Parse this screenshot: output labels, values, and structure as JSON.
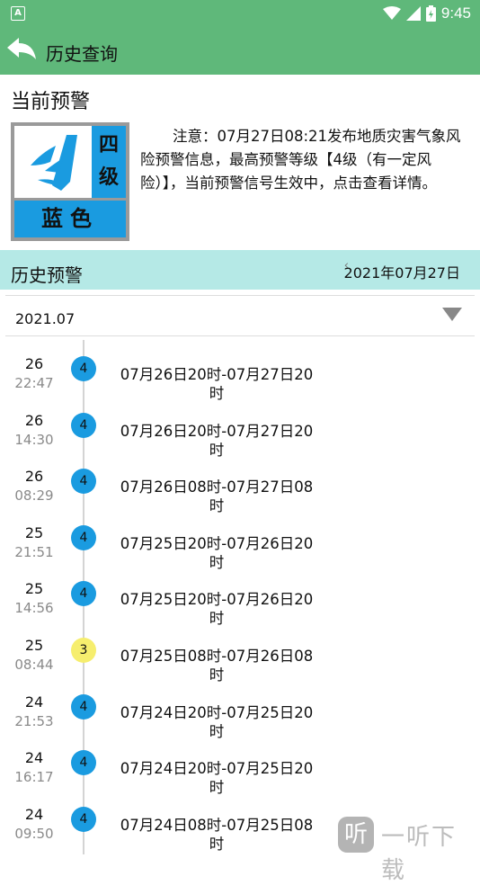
{
  "status_bar": {
    "left_icon": "A",
    "time": "9:45"
  },
  "app_bar": {
    "title": "历史查询"
  },
  "current": {
    "title": "当前预警",
    "badge": {
      "level": "四级",
      "color_name": "蓝色"
    },
    "notice": "注意：07月27日08:21发布地质灾害气象风险预警信息，最高预警等级【4级（有一定风险）】，当前预警信号生效中，点击查看详情。"
  },
  "history": {
    "title": "历史预警",
    "date": "2021年07月27日"
  },
  "month_select": {
    "value": "2021.07"
  },
  "records": [
    {
      "day": "26",
      "time": "22:47",
      "level": "4",
      "period_a": "07月26日20时-07月27日20",
      "period_b": "时"
    },
    {
      "day": "26",
      "time": "14:30",
      "level": "4",
      "period_a": "07月26日20时-07月27日20",
      "period_b": "时"
    },
    {
      "day": "26",
      "time": "08:29",
      "level": "4",
      "period_a": "07月26日08时-07月27日08",
      "period_b": "时"
    },
    {
      "day": "25",
      "time": "21:51",
      "level": "4",
      "period_a": "07月25日20时-07月26日20",
      "period_b": "时"
    },
    {
      "day": "25",
      "time": "14:56",
      "level": "4",
      "period_a": "07月25日20时-07月26日20",
      "period_b": "时"
    },
    {
      "day": "25",
      "time": "08:44",
      "level": "3",
      "period_a": "07月25日08时-07月26日08",
      "period_b": "时"
    },
    {
      "day": "24",
      "time": "21:53",
      "level": "4",
      "period_a": "07月24日20时-07月25日20",
      "period_b": "时"
    },
    {
      "day": "24",
      "time": "16:17",
      "level": "4",
      "period_a": "07月24日20时-07月25日20",
      "period_b": "时"
    },
    {
      "day": "24",
      "time": "09:50",
      "level": "4",
      "period_a": "07月24日08时-07月25日08",
      "period_b": "时"
    }
  ],
  "watermark": {
    "icon_char": "听",
    "text": "一听下载"
  },
  "colors": {
    "header": "#5fb87a",
    "history_bar": "#b5e9e6",
    "level4": "#1a9be0",
    "level3": "#f6ee6e"
  }
}
